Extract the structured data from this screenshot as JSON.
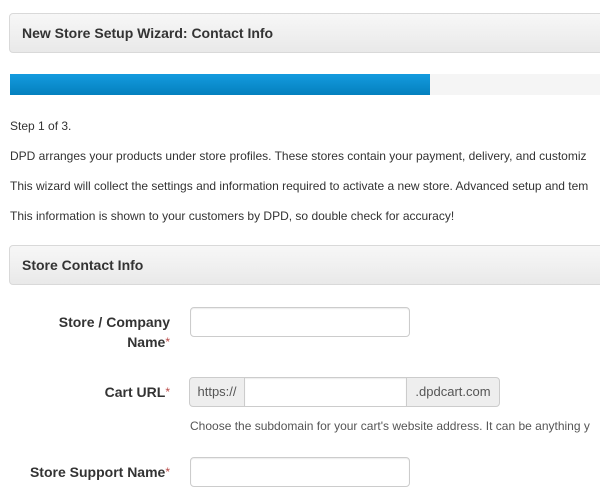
{
  "wizard": {
    "title": "New Store Setup Wizard: Contact Info",
    "progress_percent": 70,
    "step_text": "Step 1 of 3.",
    "intro_lines": [
      "DPD arranges your products under store profiles. These stores contain your payment, delivery, and customiz",
      "This wizard will collect the settings and information required to activate a new store. Advanced setup and tem",
      "This information is shown to your customers by DPD, so double check for accuracy!"
    ]
  },
  "section": {
    "title": "Store Contact Info"
  },
  "form": {
    "required_marker": "*",
    "company_name": {
      "label_line1": "Store / Company",
      "label_line2": "Name",
      "value": ""
    },
    "cart_url": {
      "label": "Cart URL",
      "prefix": "https://",
      "suffix": ".dpdcart.com",
      "value": "",
      "help": "Choose the subdomain for your cart's website address. It can be anything y"
    },
    "support_name": {
      "label": "Store Support Name",
      "value": ""
    }
  },
  "colors": {
    "progress_fill": "#0e90d2",
    "required": "#b94a48"
  }
}
